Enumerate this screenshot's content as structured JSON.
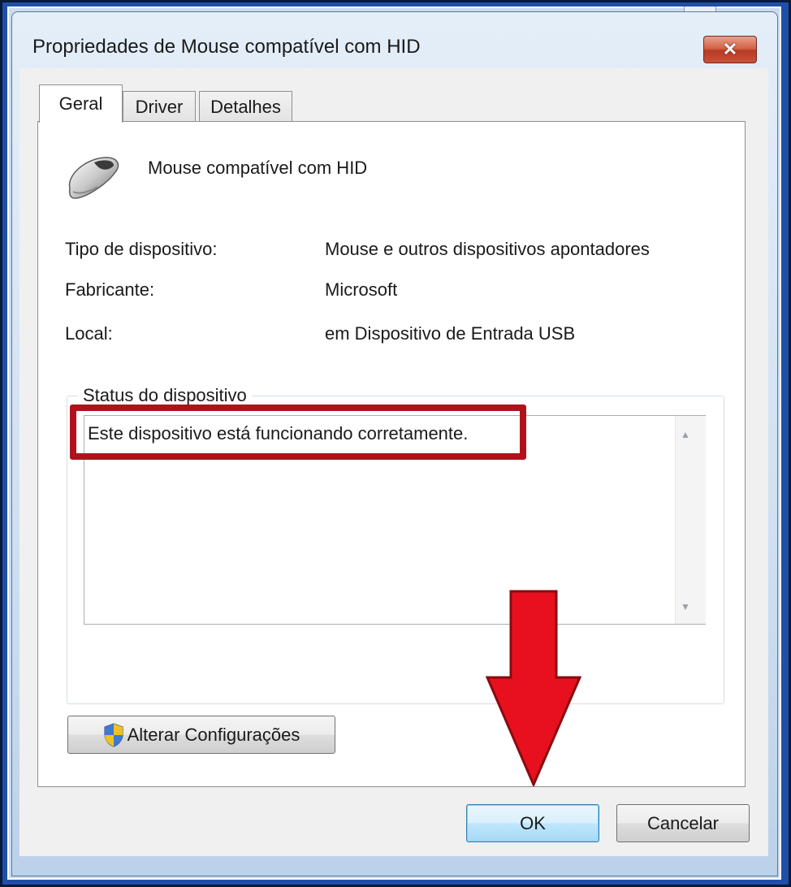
{
  "window": {
    "title": "Propriedades de Mouse compatível com HID",
    "close_label": "✕"
  },
  "tabs": [
    {
      "label": "Geral",
      "active": true
    },
    {
      "label": "Driver",
      "active": false
    },
    {
      "label": "Detalhes",
      "active": false
    }
  ],
  "device": {
    "icon": "mouse-icon",
    "name": "Mouse compatível com HID"
  },
  "properties": [
    {
      "label": "Tipo de dispositivo:",
      "value": "Mouse e outros dispositivos apontadores"
    },
    {
      "label": "Fabricante:",
      "value": "Microsoft"
    },
    {
      "label": "Local:",
      "value": "em Dispositivo de Entrada USB"
    }
  ],
  "status": {
    "group_label": "Status do dispositivo",
    "text": "Este dispositivo está funcionando corretamente."
  },
  "buttons": {
    "change_settings": "Alterar Configurações",
    "ok": "OK",
    "cancel": "Cancelar"
  },
  "annotations": {
    "highlight_color": "#b0121c",
    "arrow_color": "#e8101e"
  },
  "colors": {
    "close_button": "#c9533a",
    "default_button": "#a7d9f5"
  }
}
